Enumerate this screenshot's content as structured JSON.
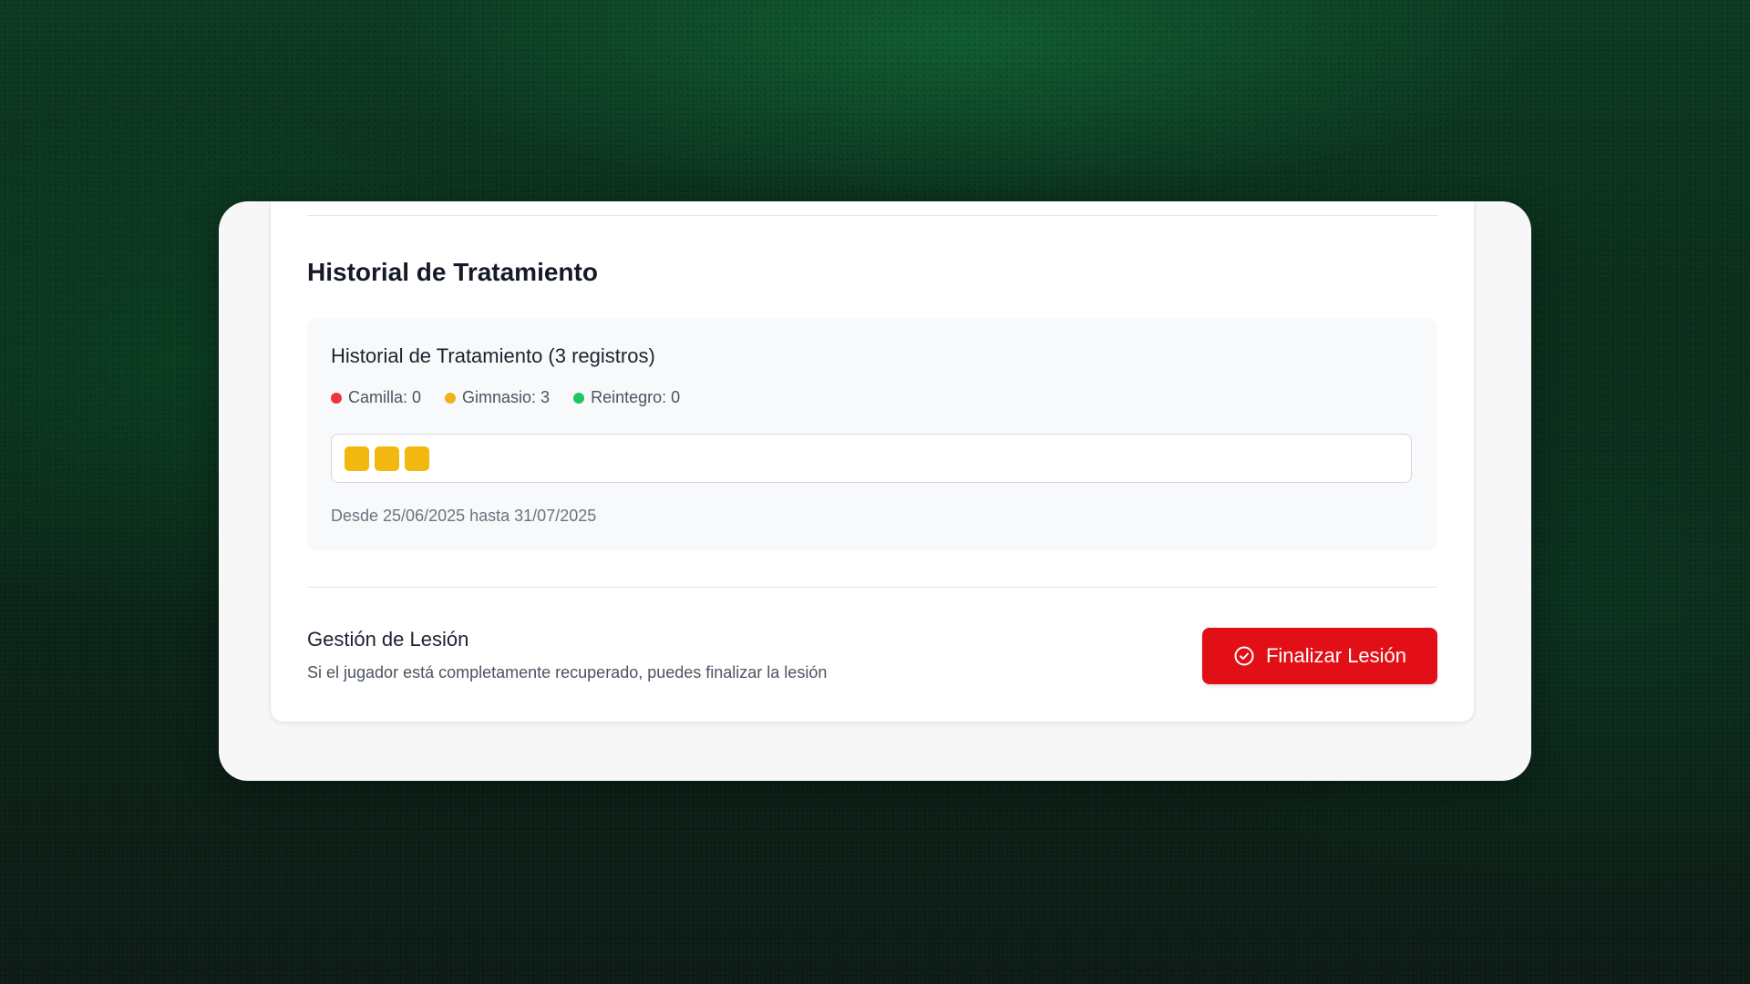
{
  "section": {
    "title": "Historial de Tratamiento"
  },
  "history": {
    "title": "Historial de Tratamiento (3 registros)",
    "legend": [
      {
        "label": "Camilla: 0",
        "color": "#ef3340"
      },
      {
        "label": "Gimnasio: 3",
        "color": "#f2b01e"
      },
      {
        "label": "Reintegro: 0",
        "color": "#22c55e"
      }
    ],
    "timeline": {
      "segments": [
        "gimnasio",
        "gimnasio",
        "gimnasio"
      ],
      "segment_color": "#f2b80f"
    },
    "range": "Desde 25/06/2025 hasta 31/07/2025"
  },
  "management": {
    "title": "Gestión de Lesión",
    "description": "Si el jugador está completamente recuperado, puedes finalizar la lesión",
    "button_label": "Finalizar Lesión",
    "button_icon": "check-circle-icon",
    "button_color": "#e30f17"
  }
}
